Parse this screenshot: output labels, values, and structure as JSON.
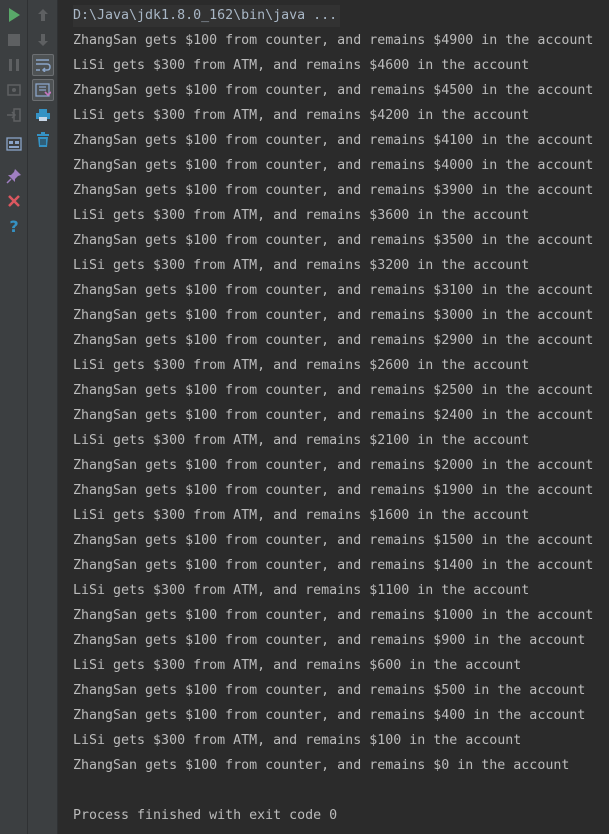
{
  "command_line": "D:\\Java\\jdk1.8.0_162\\bin\\java ...",
  "output_lines": [
    "ZhangSan gets $100 from counter, and remains $4900 in the account",
    "LiSi gets $300 from ATM, and remains $4600 in the account",
    "ZhangSan gets $100 from counter, and remains $4500 in the account",
    "LiSi gets $300 from ATM, and remains $4200 in the account",
    "ZhangSan gets $100 from counter, and remains $4100 in the account",
    "ZhangSan gets $100 from counter, and remains $4000 in the account",
    "ZhangSan gets $100 from counter, and remains $3900 in the account",
    "LiSi gets $300 from ATM, and remains $3600 in the account",
    "ZhangSan gets $100 from counter, and remains $3500 in the account",
    "LiSi gets $300 from ATM, and remains $3200 in the account",
    "ZhangSan gets $100 from counter, and remains $3100 in the account",
    "ZhangSan gets $100 from counter, and remains $3000 in the account",
    "ZhangSan gets $100 from counter, and remains $2900 in the account",
    "LiSi gets $300 from ATM, and remains $2600 in the account",
    "ZhangSan gets $100 from counter, and remains $2500 in the account",
    "ZhangSan gets $100 from counter, and remains $2400 in the account",
    "LiSi gets $300 from ATM, and remains $2100 in the account",
    "ZhangSan gets $100 from counter, and remains $2000 in the account",
    "ZhangSan gets $100 from counter, and remains $1900 in the account",
    "LiSi gets $300 from ATM, and remains $1600 in the account",
    "ZhangSan gets $100 from counter, and remains $1500 in the account",
    "ZhangSan gets $100 from counter, and remains $1400 in the account",
    "LiSi gets $300 from ATM, and remains $1100 in the account",
    "ZhangSan gets $100 from counter, and remains $1000 in the account",
    "ZhangSan gets $100 from counter, and remains $900 in the account",
    "LiSi gets $300 from ATM, and remains $600 in the account",
    "ZhangSan gets $100 from counter, and remains $500 in the account",
    "ZhangSan gets $100 from counter, and remains $400 in the account",
    "LiSi gets $300 from ATM, and remains $100 in the account",
    "ZhangSan gets $100 from counter, and remains $0 in the account"
  ],
  "exit_message": "Process finished with exit code 0",
  "toolbar": {
    "left": [
      "rerun-icon",
      "stop-icon",
      "pause-icon",
      "dump-threads-icon",
      "exit-icon",
      "layout-icon",
      "pin-icon",
      "close-icon",
      "help-icon"
    ],
    "right": [
      "up-arrow-icon",
      "down-arrow-icon",
      "soft-wrap-icon",
      "scroll-to-end-icon",
      "print-icon",
      "clear-all-icon"
    ]
  },
  "colors": {
    "background": "#2b2b2b",
    "text": "#bbbbbb",
    "toolbar": "#3c3f41",
    "run_green": "#59a869",
    "close_red": "#db5860",
    "help_blue": "#3592c4"
  }
}
